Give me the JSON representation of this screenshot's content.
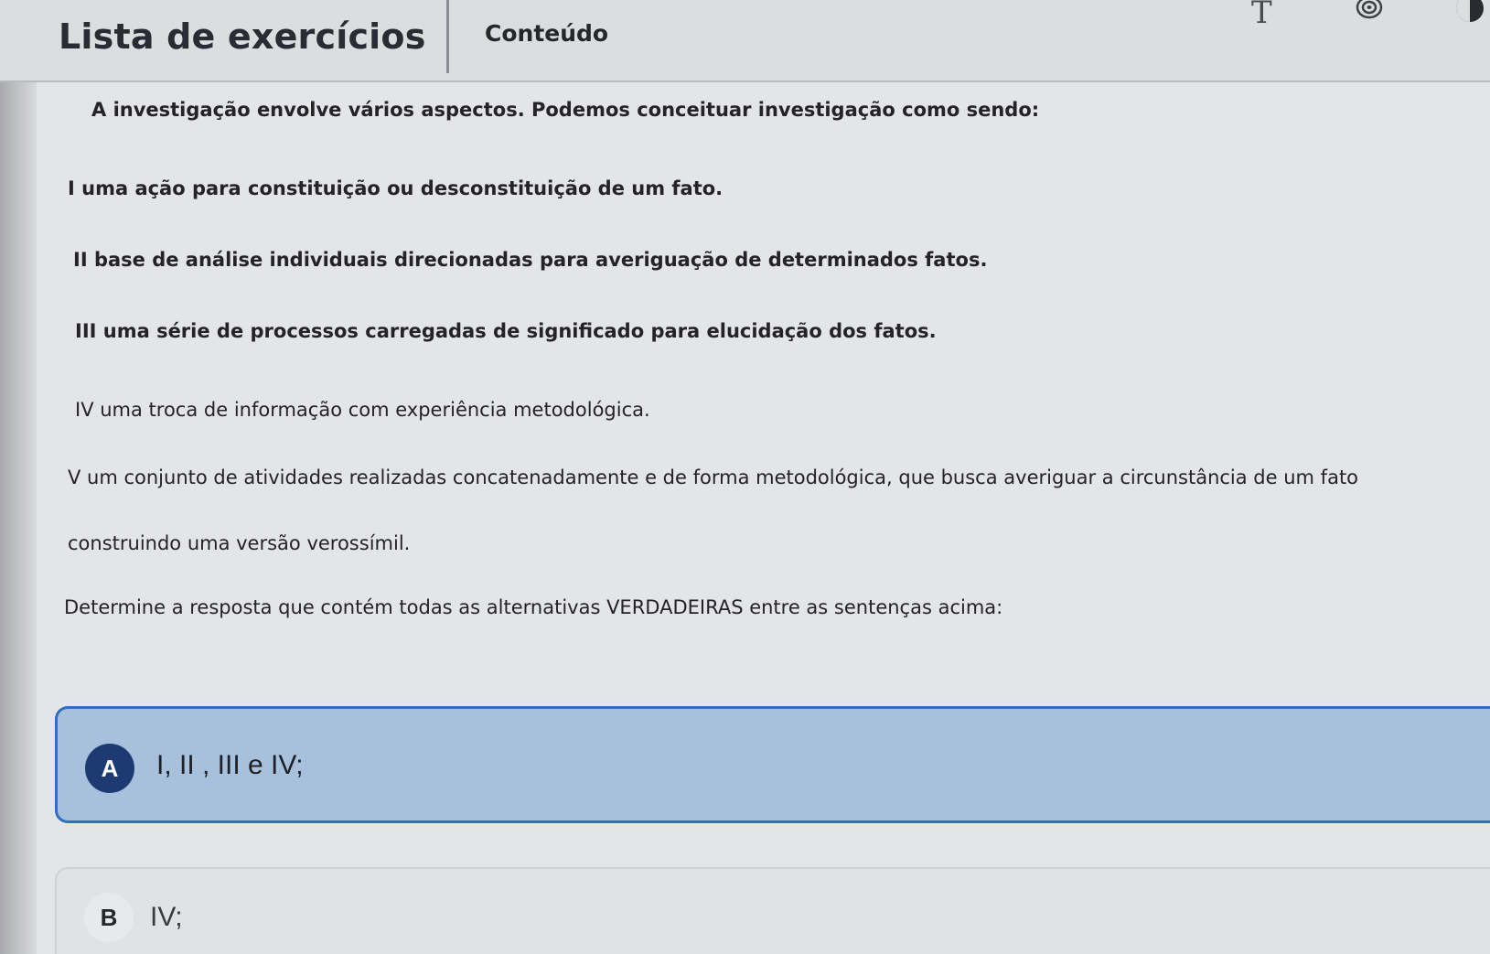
{
  "header": {
    "title": "Lista de exercícios",
    "tab_label": "Conteúdo",
    "font_icon_glyph": "T",
    "icons": [
      "font-size-icon",
      "target-icon",
      "contrast-icon"
    ]
  },
  "question": {
    "intro": "A investigação envolve vários aspectos. Podemos conceituar investigação como sendo:",
    "statements": [
      "I uma ação para constituição ou desconstituição de um fato.",
      "II base de análise individuais direcionadas para averiguação de determinados fatos.",
      "III uma série de processos carregadas de significado para elucidação dos fatos.",
      "IV uma troca de informação com experiência metodológica."
    ],
    "statement_v_line1": "V um conjunto de atividades realizadas concatenadamente e de forma metodológica, que busca averiguar a circunstância de um fato",
    "statement_v_line2": "construindo uma versão verossímil.",
    "prompt": "Determine a resposta que contém todas as alternativas VERDADEIRAS  entre as sentenças acima:"
  },
  "options": [
    {
      "letter": "A",
      "text": "I, II , III e IV;",
      "selected": true
    },
    {
      "letter": "B",
      "text": "IV;",
      "selected": false
    }
  ],
  "colors": {
    "selected_option_bg": "#a7c1dd",
    "selected_option_border": "#2f6fbf",
    "selected_letter_bg": "#1e3a72"
  }
}
